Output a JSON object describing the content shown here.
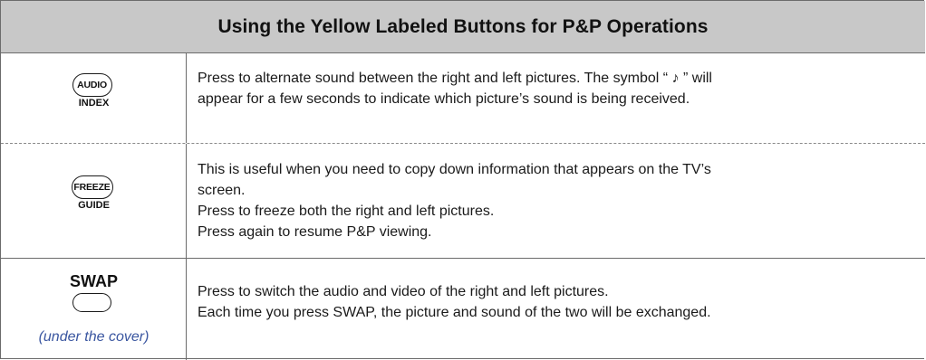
{
  "header": {
    "title": "Using the Yellow Labeled Buttons for P&P Operations"
  },
  "rows": [
    {
      "button": {
        "pill_label": "AUDIO",
        "sub_label": "INDEX",
        "icon": "audio-index-button-icon"
      },
      "description": [
        "Press to alternate sound between the right and left pictures. The symbol “ ♪ ”  will",
        "appear for a few seconds to indicate which picture’s sound is being received."
      ]
    },
    {
      "button": {
        "pill_label": "FREEZE",
        "sub_label": "GUIDE",
        "icon": "freeze-guide-button-icon"
      },
      "description": [
        "This is useful when you need to copy down information that appears on the TV’s",
        "screen.",
        "Press to freeze both the right and left pictures.",
        "Press again to resume P&P viewing."
      ]
    },
    {
      "button": {
        "label": "SWAP",
        "note": "(under the cover)",
        "icon": "swap-button-icon"
      },
      "description": [
        "Press to switch the audio and video of the right and left pictures.",
        "Each time you press SWAP, the picture and sound of the two will be exchanged."
      ]
    }
  ],
  "colors": {
    "header_bg": "#c8c8c8",
    "border": "#6b6b6b",
    "note_text": "#3a56a0",
    "body_text": "#1a1a1a"
  }
}
